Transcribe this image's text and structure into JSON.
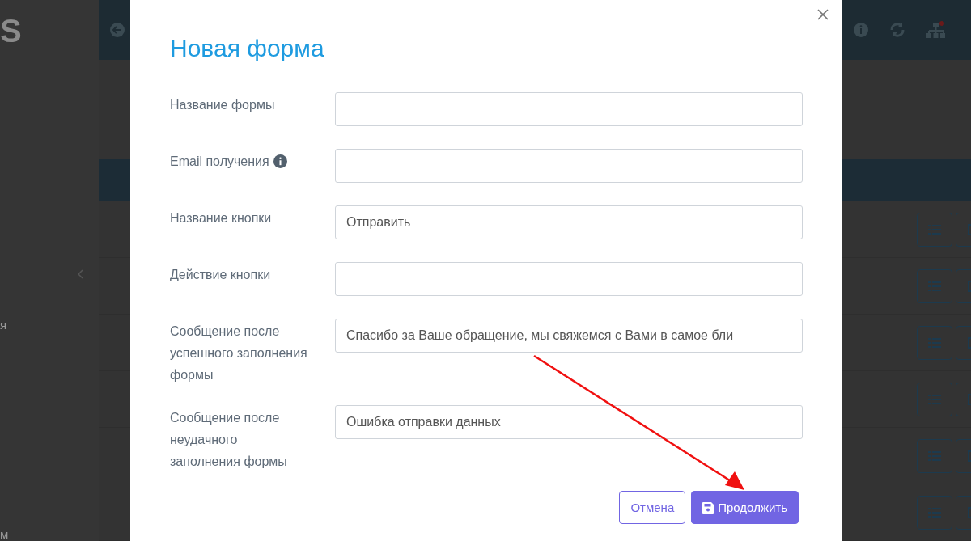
{
  "background": {
    "logo_text": "S",
    "sidebar_fragments": [
      "я",
      "м"
    ]
  },
  "modal": {
    "title": "Новая форма",
    "fields": [
      {
        "label": "Название формы",
        "info": false
      },
      {
        "label": "Email получения",
        "info": true
      },
      {
        "label": "Название кнопки",
        "value": "Отправить",
        "info": false
      },
      {
        "label": "Действие кнопки",
        "info": false
      },
      {
        "label": "Сообщение после успешного заполнения формы",
        "value": "Спасибо за Ваше обращение, мы свяжемся с Вами в самое бли",
        "info": false
      },
      {
        "label": "Сообщение после неудачного заполнения формы",
        "value": "Ошибка отправки данных",
        "info": false
      }
    ],
    "buttons": [
      {
        "label": "Отмена",
        "kind": "secondary"
      },
      {
        "label": "Продолжить",
        "kind": "primary"
      }
    ]
  }
}
